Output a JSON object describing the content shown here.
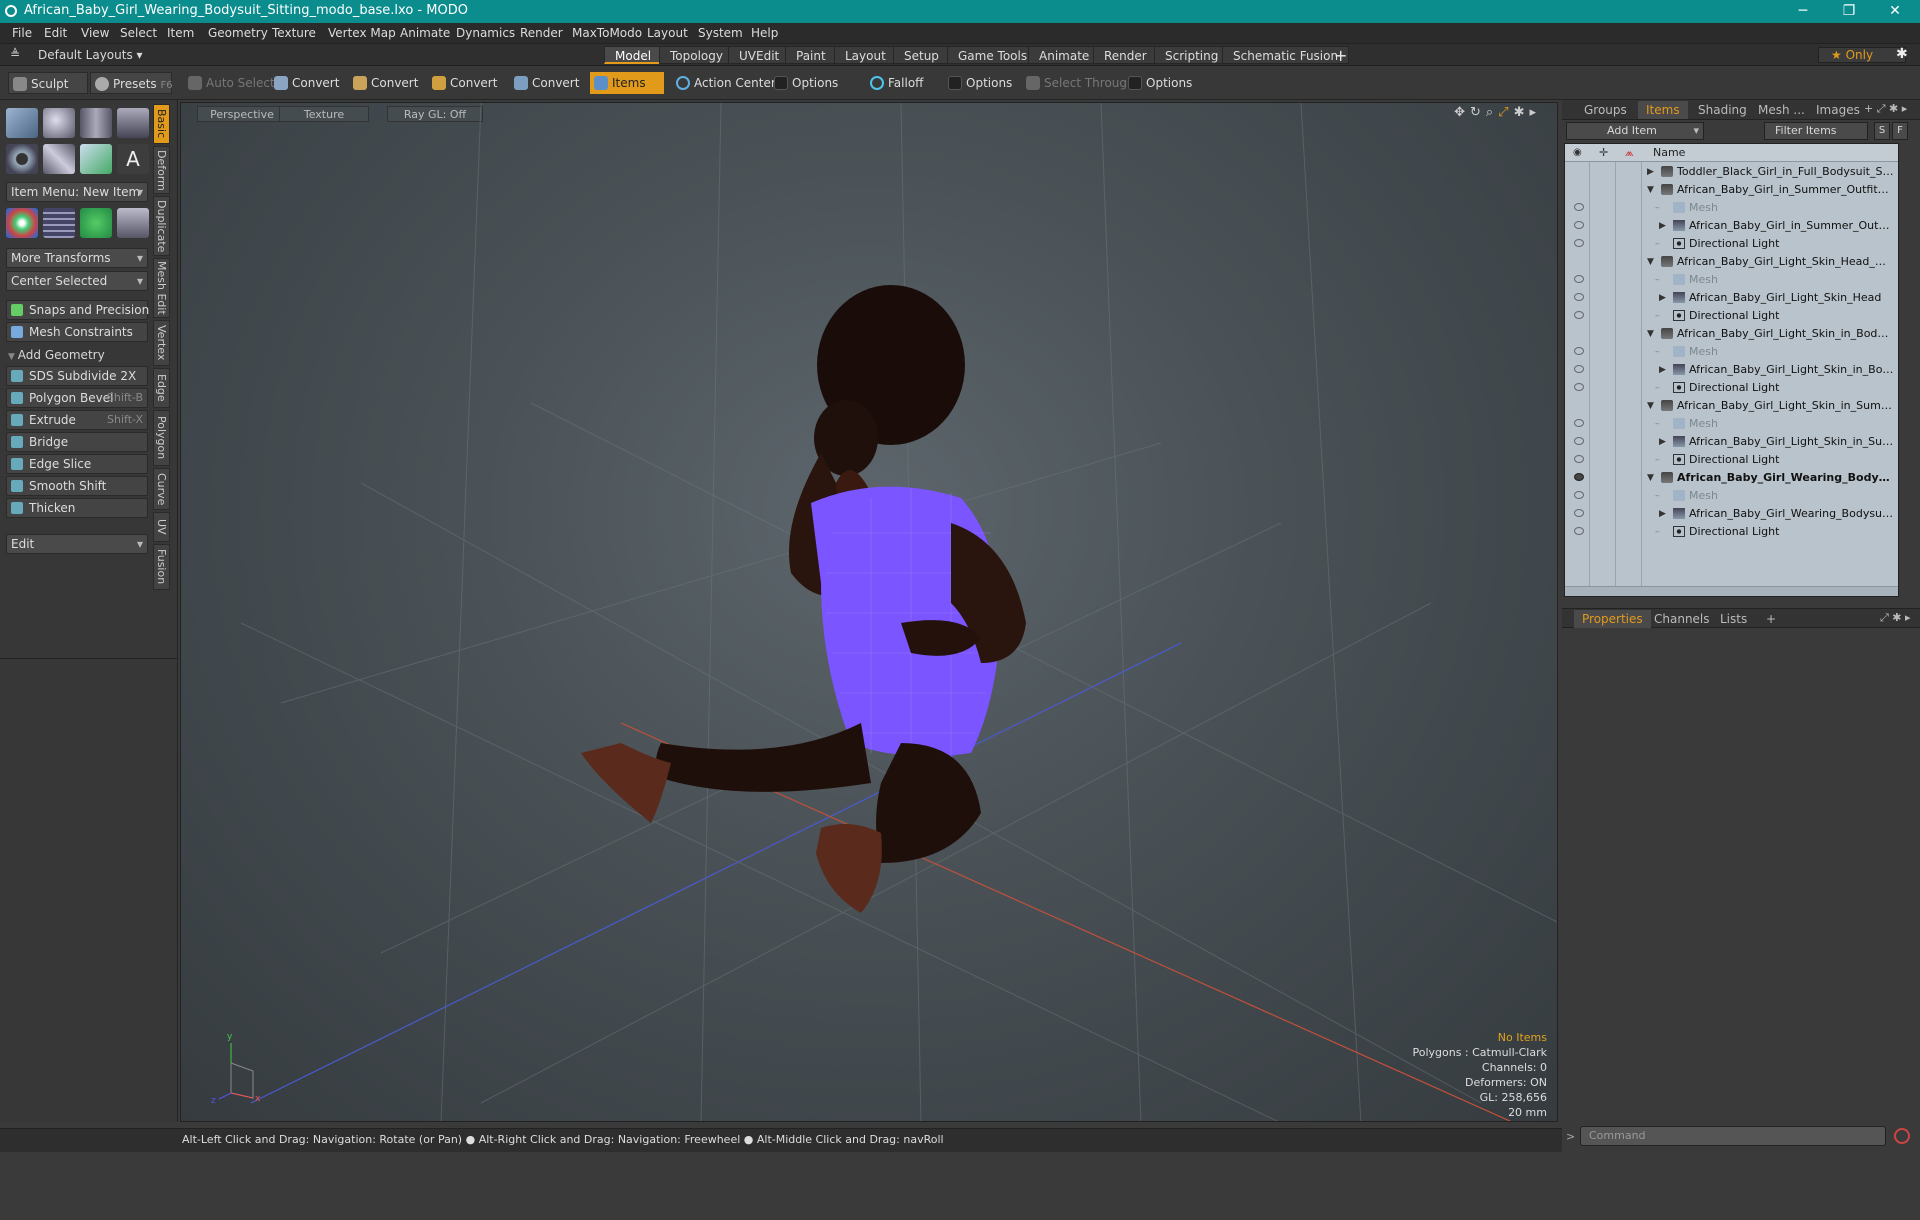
{
  "window": {
    "title": "African_Baby_Girl_Wearing_Bodysuit_Sitting_modo_base.lxo - MODO",
    "min": "─",
    "max": "❐",
    "close": "✕"
  },
  "menu": [
    "File",
    "Edit",
    "View",
    "Select",
    "Item",
    "Geometry",
    "Texture",
    "Vertex Map",
    "Animate",
    "Dynamics",
    "Render",
    "MaxToModo",
    "Layout",
    "System",
    "Help"
  ],
  "layoutbar": {
    "layouts": "Default Layouts ▾",
    "tabs": [
      "Model",
      "Topology",
      "UVEdit",
      "Paint",
      "Layout",
      "Setup",
      "Game Tools",
      "Animate",
      "Render",
      "Scripting",
      "Schematic Fusion"
    ],
    "active_tab": "Model",
    "add": "+",
    "only": "★  Only",
    "gear": "✱"
  },
  "toolbar": {
    "sculpt": "Sculpt",
    "presets": "Presets",
    "presets_key": "F6",
    "auto_select": "Auto Select",
    "convert": "Convert",
    "items": "Items",
    "action_center": "Action Center",
    "options": "Options",
    "falloff": "Falloff",
    "select_through": "Select Through"
  },
  "left": {
    "item_menu": "Item Menu: New Item",
    "more_transforms": "More Transforms",
    "center_selected": "Center Selected",
    "snaps": "Snaps and Precision",
    "mesh_constraints": "Mesh Constraints",
    "add_geometry": "Add Geometry",
    "tools": [
      {
        "label": "SDS Subdivide 2X",
        "key": ""
      },
      {
        "label": "Polygon Bevel",
        "key": "Shift-B"
      },
      {
        "label": "Extrude",
        "key": "Shift-X"
      },
      {
        "label": "Bridge",
        "key": ""
      },
      {
        "label": "Edge Slice",
        "key": ""
      },
      {
        "label": "Smooth Shift",
        "key": ""
      },
      {
        "label": "Thicken",
        "key": ""
      }
    ],
    "edit": "Edit",
    "vtabs": [
      "Basic",
      "Deform",
      "Duplicate",
      "Mesh Edit",
      "Vertex",
      "Edge",
      "Polygon",
      "Curve",
      "UV",
      "Fusion"
    ]
  },
  "viewport": {
    "perspective": "Perspective",
    "texture": "Texture",
    "raygl": "Ray GL: Off",
    "info": {
      "no_items": "No Items",
      "polygons": "Polygons : Catmull-Clark",
      "channels": "Channels: 0",
      "deformers": "Deformers: ON",
      "gl": "GL: 258,656",
      "scale": "20 mm"
    }
  },
  "right": {
    "tabs": [
      "Groups",
      "Items",
      "Shading",
      "Mesh ...",
      "Images"
    ],
    "active_tab": "Items",
    "add_item": "Add Item",
    "filter": "Filter Items",
    "s": "S",
    "f": "F",
    "name_col": "Name",
    "rows": [
      {
        "label": "Toddler_Black_Girl_in_Full_Bodysuit_Standi ...",
        "level": 0,
        "tri": "▶",
        "eye": false,
        "style": "scene"
      },
      {
        "label": "African_Baby_Girl_in_Summer_Outfit_Surp ...",
        "level": 0,
        "tri": "▼",
        "eye": false,
        "style": "scene"
      },
      {
        "label": "Mesh",
        "level": 1,
        "tri": "",
        "eye": true,
        "style": "dim"
      },
      {
        "label": "African_Baby_Girl_in_Summer_Outfit_Su...",
        "level": 1,
        "tri": "▶",
        "eye": true,
        "style": "mesh"
      },
      {
        "label": "Directional Light",
        "level": 1,
        "tri": "",
        "eye": true,
        "style": "light"
      },
      {
        "label": "African_Baby_Girl_Light_Skin_Head_modo ...",
        "level": 0,
        "tri": "▼",
        "eye": false,
        "style": "scene"
      },
      {
        "label": "Mesh",
        "level": 1,
        "tri": "",
        "eye": true,
        "style": "dim"
      },
      {
        "label": "African_Baby_Girl_Light_Skin_Head",
        "level": 1,
        "tri": "▶",
        "eye": true,
        "style": "mesh"
      },
      {
        "label": "Directional Light",
        "level": 1,
        "tri": "",
        "eye": true,
        "style": "light"
      },
      {
        "label": "African_Baby_Girl_Light_Skin_in_Bodysuit_...",
        "level": 0,
        "tri": "▼",
        "eye": false,
        "style": "scene"
      },
      {
        "label": "Mesh",
        "level": 1,
        "tri": "",
        "eye": true,
        "style": "dim"
      },
      {
        "label": "African_Baby_Girl_Light_Skin_in_Bodysu...",
        "level": 1,
        "tri": "▶",
        "eye": true,
        "style": "mesh"
      },
      {
        "label": "Directional Light",
        "level": 1,
        "tri": "",
        "eye": true,
        "style": "light"
      },
      {
        "label": "African_Baby_Girl_Light_Skin_in_Summer_ ...",
        "level": 0,
        "tri": "▼",
        "eye": false,
        "style": "scene"
      },
      {
        "label": "Mesh",
        "level": 1,
        "tri": "",
        "eye": true,
        "style": "dim"
      },
      {
        "label": "African_Baby_Girl_Light_Skin_in_Summe ...",
        "level": 1,
        "tri": "▶",
        "eye": true,
        "style": "mesh"
      },
      {
        "label": "Directional Light",
        "level": 1,
        "tri": "",
        "eye": true,
        "style": "light"
      },
      {
        "label": "African_Baby_Girl_Wearing_Bodysui...",
        "level": 0,
        "tri": "▼",
        "eye": true,
        "style": "bold"
      },
      {
        "label": "Mesh",
        "level": 1,
        "tri": "",
        "eye": true,
        "style": "dim"
      },
      {
        "label": "African_Baby_Girl_Wearing_Bodysuit_Si ...",
        "level": 1,
        "tri": "▶",
        "eye": true,
        "style": "mesh"
      },
      {
        "label": "Directional Light",
        "level": 1,
        "tri": "",
        "eye": true,
        "style": "light"
      }
    ],
    "props_tabs": [
      "Properties",
      "Channels",
      "Lists"
    ],
    "props_active": "Properties",
    "props_add": "+",
    "command": "Command"
  },
  "status": "Alt-Left Click and Drag: Navigation: Rotate (or Pan) ● Alt-Right Click and Drag: Navigation: Freewheel ● Alt-Middle Click and Drag: navRoll",
  "colors": {
    "accent": "#e29a1b",
    "titlebar": "#0b8d8e",
    "bodysuit": "#7b55ff"
  }
}
